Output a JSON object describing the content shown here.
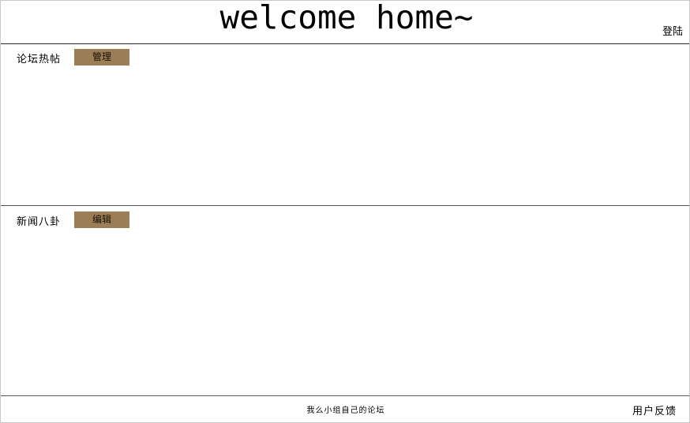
{
  "header": {
    "title": "welcome home~",
    "login_label": "登陆"
  },
  "sections": [
    {
      "label": "论坛热帖",
      "button_label": "管理"
    },
    {
      "label": "新闻八卦",
      "button_label": "编辑"
    }
  ],
  "footer": {
    "text": "我么小组自己的论坛",
    "feedback_label": "用户反馈"
  },
  "colors": {
    "button_bg": "#9b7e55",
    "divider": "#2a2a2a",
    "page_bg": "#ffffff"
  }
}
